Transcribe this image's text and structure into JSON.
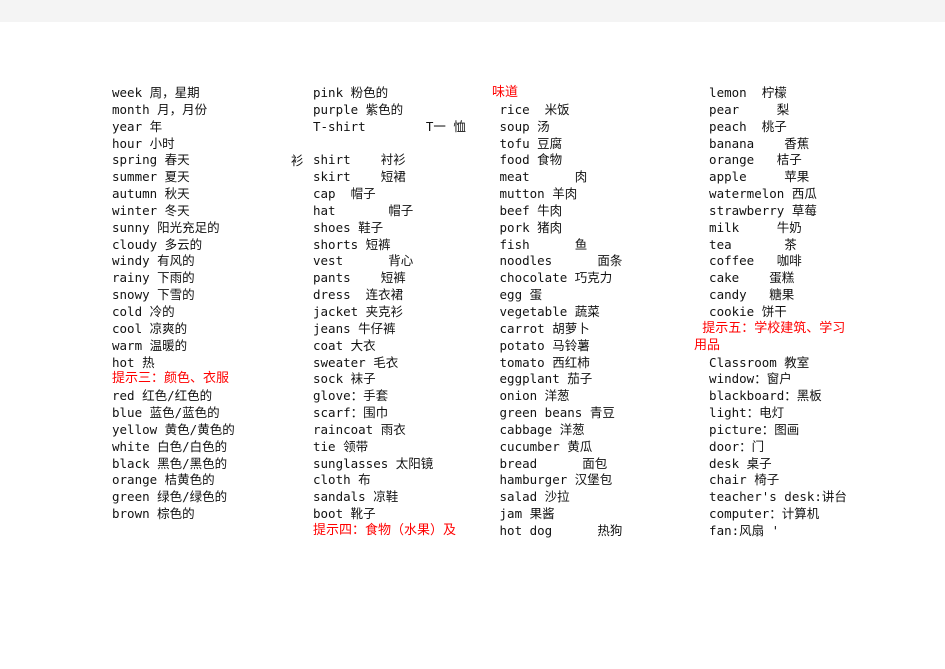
{
  "document": {
    "type": "vocabulary-word-list",
    "heading_color": "#ff0000",
    "text_color": "#111111",
    "background": "#ffffff"
  },
  "orphan_fragment": "衫",
  "columns": [
    {
      "id": "col1",
      "entries": [
        {
          "kind": "entry",
          "text": "week 周，星期"
        },
        {
          "kind": "entry",
          "text": "month 月，月份"
        },
        {
          "kind": "entry",
          "text": "year 年"
        },
        {
          "kind": "entry",
          "text": "hour 小时"
        },
        {
          "kind": "entry",
          "text": "spring 春天"
        },
        {
          "kind": "entry",
          "text": "summer 夏天"
        },
        {
          "kind": "entry",
          "text": "autumn 秋天"
        },
        {
          "kind": "entry",
          "text": "winter 冬天"
        },
        {
          "kind": "entry",
          "text": "sunny 阳光充足的"
        },
        {
          "kind": "entry",
          "text": "cloudy 多云的"
        },
        {
          "kind": "entry",
          "text": "windy 有风的"
        },
        {
          "kind": "entry",
          "text": "rainy 下雨的"
        },
        {
          "kind": "entry",
          "text": "snowy 下雪的"
        },
        {
          "kind": "entry",
          "text": "cold 冷的"
        },
        {
          "kind": "entry",
          "text": "cool 凉爽的"
        },
        {
          "kind": "entry",
          "text": "warm 温暖的"
        },
        {
          "kind": "entry",
          "text": "hot 热"
        },
        {
          "kind": "heading",
          "text": "提示三：颜色、衣服"
        },
        {
          "kind": "entry",
          "text": "red 红色/红色的"
        },
        {
          "kind": "entry",
          "text": "blue 蓝色/蓝色的"
        },
        {
          "kind": "entry",
          "text": "yellow 黄色/黄色的"
        },
        {
          "kind": "entry",
          "text": "white 白色/白色的"
        },
        {
          "kind": "entry",
          "text": "black 黑色/黑色的"
        },
        {
          "kind": "entry",
          "text": "orange 桔黄色的"
        },
        {
          "kind": "entry",
          "text": "green 绿色/绿色的"
        },
        {
          "kind": "entry",
          "text": "brown 棕色的"
        }
      ]
    },
    {
      "id": "col2",
      "entries": [
        {
          "kind": "entry",
          "text": "pink 粉色的"
        },
        {
          "kind": "entry",
          "text": "purple 紫色的"
        },
        {
          "kind": "entry",
          "text": "T-shirt        T一 恤"
        },
        {
          "kind": "spacer",
          "text": ""
        },
        {
          "kind": "entry",
          "text": "shirt    衬衫"
        },
        {
          "kind": "entry",
          "text": "skirt    短裙"
        },
        {
          "kind": "entry",
          "text": "cap  帽子"
        },
        {
          "kind": "entry",
          "text": "hat       帽子"
        },
        {
          "kind": "entry",
          "text": "shoes 鞋子"
        },
        {
          "kind": "entry",
          "text": "shorts 短裤"
        },
        {
          "kind": "entry",
          "text": "vest      背心"
        },
        {
          "kind": "entry",
          "text": "pants    短裤"
        },
        {
          "kind": "entry",
          "text": "dress  连衣裙"
        },
        {
          "kind": "entry",
          "text": "jacket 夹克衫"
        },
        {
          "kind": "entry",
          "text": "jeans 牛仔裤"
        },
        {
          "kind": "entry",
          "text": "coat 大衣"
        },
        {
          "kind": "entry",
          "text": "sweater 毛衣"
        },
        {
          "kind": "entry",
          "text": "sock 袜子"
        },
        {
          "kind": "entry",
          "text": "glove：手套"
        },
        {
          "kind": "entry",
          "text": "scarf：围巾"
        },
        {
          "kind": "entry",
          "text": "raincoat 雨衣"
        },
        {
          "kind": "entry",
          "text": "tie 领带"
        },
        {
          "kind": "entry",
          "text": "sunglasses 太阳镜"
        },
        {
          "kind": "entry",
          "text": "cloth 布"
        },
        {
          "kind": "entry",
          "text": "sandals 凉鞋"
        },
        {
          "kind": "entry",
          "text": "boot 靴子"
        },
        {
          "kind": "heading",
          "text": "提示四：食物（水果）及"
        }
      ]
    },
    {
      "id": "col3",
      "entries": [
        {
          "kind": "heading",
          "text": "味道"
        },
        {
          "kind": "entry",
          "text": " rice  米饭"
        },
        {
          "kind": "entry",
          "text": " soup 汤"
        },
        {
          "kind": "entry",
          "text": " tofu 豆腐"
        },
        {
          "kind": "entry",
          "text": " food 食物"
        },
        {
          "kind": "entry",
          "text": " meat      肉"
        },
        {
          "kind": "entry",
          "text": " mutton 羊肉"
        },
        {
          "kind": "entry",
          "text": " beef 牛肉"
        },
        {
          "kind": "entry",
          "text": " pork 猪肉"
        },
        {
          "kind": "entry",
          "text": " fish      鱼"
        },
        {
          "kind": "entry",
          "text": " noodles      面条"
        },
        {
          "kind": "entry",
          "text": " chocolate 巧克力"
        },
        {
          "kind": "entry",
          "text": " egg 蛋"
        },
        {
          "kind": "entry",
          "text": " vegetable 蔬菜"
        },
        {
          "kind": "entry",
          "text": " carrot 胡萝卜"
        },
        {
          "kind": "entry",
          "text": " potato 马铃薯"
        },
        {
          "kind": "entry",
          "text": " tomato 西红柿"
        },
        {
          "kind": "entry",
          "text": " eggplant 茄子"
        },
        {
          "kind": "entry",
          "text": " onion 洋葱"
        },
        {
          "kind": "entry",
          "text": " green beans 青豆"
        },
        {
          "kind": "entry",
          "text": " cabbage 洋葱"
        },
        {
          "kind": "entry",
          "text": " cucumber 黄瓜"
        },
        {
          "kind": "entry",
          "text": " bread      面包"
        },
        {
          "kind": "entry",
          "text": " hamburger 汉堡包"
        },
        {
          "kind": "entry",
          "text": " salad 沙拉"
        },
        {
          "kind": "entry",
          "text": " jam 果酱"
        },
        {
          "kind": "entry",
          "text": " hot dog      热狗"
        }
      ]
    },
    {
      "id": "col4",
      "entries": [
        {
          "kind": "entry",
          "text": "  lemon  柠檬"
        },
        {
          "kind": "entry",
          "text": "  pear     梨"
        },
        {
          "kind": "entry",
          "text": "  peach  桃子"
        },
        {
          "kind": "entry",
          "text": "  banana    香蕉"
        },
        {
          "kind": "entry",
          "text": "  orange   桔子"
        },
        {
          "kind": "entry",
          "text": "  apple     苹果"
        },
        {
          "kind": "entry",
          "text": "  watermelon 西瓜"
        },
        {
          "kind": "entry",
          "text": "  strawberry 草莓"
        },
        {
          "kind": "entry",
          "text": "  milk     牛奶"
        },
        {
          "kind": "entry",
          "text": "  tea       茶"
        },
        {
          "kind": "entry",
          "text": "  coffee   咖啡"
        },
        {
          "kind": "entry",
          "text": "  cake    蛋糕"
        },
        {
          "kind": "entry",
          "text": "  candy   糖果"
        },
        {
          "kind": "entry",
          "text": "  cookie 饼干"
        },
        {
          "kind": "heading",
          "text": "  提示五：学校建筑、学习"
        },
        {
          "kind": "heading",
          "text": "用品"
        },
        {
          "kind": "entry",
          "text": "  Classroom 教室"
        },
        {
          "kind": "entry",
          "text": "  window：窗户"
        },
        {
          "kind": "entry",
          "text": "  blackboard：黑板"
        },
        {
          "kind": "entry",
          "text": "  light：电灯"
        },
        {
          "kind": "entry",
          "text": "  picture：图画"
        },
        {
          "kind": "entry",
          "text": "  door：门"
        },
        {
          "kind": "entry",
          "text": "  desk 桌子"
        },
        {
          "kind": "entry",
          "text": "  chair 椅子"
        },
        {
          "kind": "entry",
          "text": "  teacher's desk:讲台"
        },
        {
          "kind": "entry",
          "text": "  computer：计算机"
        },
        {
          "kind": "entry",
          "text": "  fan:风扇 '"
        }
      ]
    }
  ]
}
